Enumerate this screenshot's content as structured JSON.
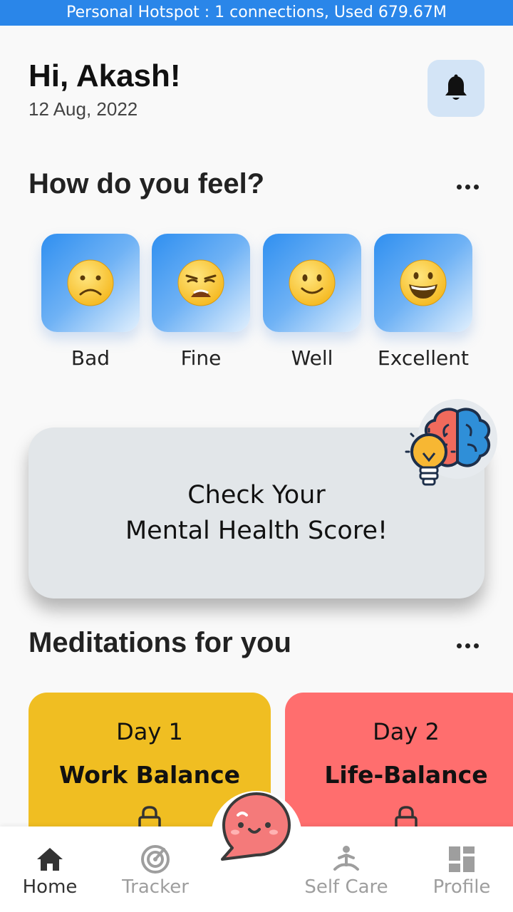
{
  "status_bar": {
    "text": "Personal Hotspot : 1 connections, Used 679.67M"
  },
  "header": {
    "greeting": "Hi, Akash!",
    "date": "12 Aug, 2022",
    "bell_icon": "bell-icon"
  },
  "mood_section": {
    "title": "How do you feel?",
    "moods": [
      {
        "label": "Bad",
        "emoji": "frowning-face"
      },
      {
        "label": "Fine",
        "emoji": "weary-face"
      },
      {
        "label": "Well",
        "emoji": "slightly-smiling-face"
      },
      {
        "label": "Excellent",
        "emoji": "grinning-face"
      }
    ]
  },
  "score_card": {
    "line1": "Check Your",
    "line2": "Mental Health Score!",
    "icon": "brain-lightbulb-icon"
  },
  "meditations": {
    "title": "Meditations for you",
    "cards": [
      {
        "day": "Day 1",
        "name": "Work Balance",
        "color": "#f0be22",
        "locked": true
      },
      {
        "day": "Day 2",
        "name": "Life-Balance",
        "color": "#ff6e6e",
        "locked": true
      }
    ]
  },
  "bottom_nav": {
    "items": [
      {
        "label": "Home",
        "icon": "home-icon",
        "active": true
      },
      {
        "label": "Tracker",
        "icon": "tracker-icon",
        "active": false
      },
      {
        "label": "Self Care",
        "icon": "self-care-icon",
        "active": false
      },
      {
        "label": "Profile",
        "icon": "profile-icon",
        "active": false
      }
    ],
    "center_button_icon": "chat-bubble-icon"
  },
  "colors": {
    "accent": "#2a86e9",
    "active_nav": "#333333",
    "inactive_nav": "#9e9e9e"
  }
}
